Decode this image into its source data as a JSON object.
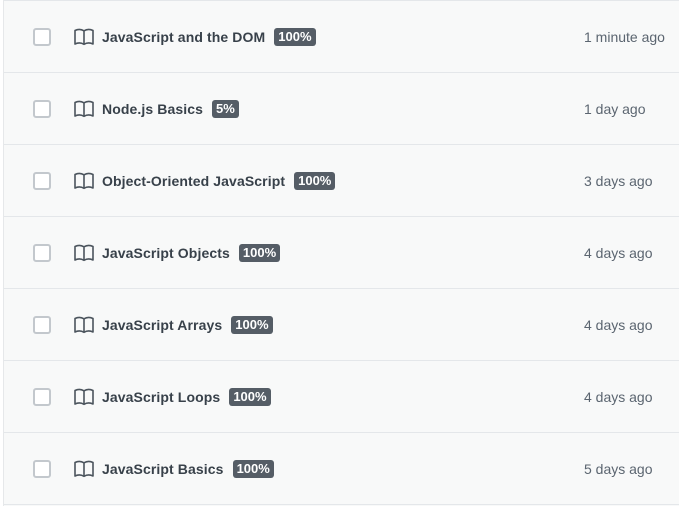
{
  "courses": [
    {
      "title": "JavaScript and the DOM",
      "progress": "100%",
      "time": "1 minute ago"
    },
    {
      "title": "Node.js Basics",
      "progress": "5%",
      "time": "1 day ago"
    },
    {
      "title": "Object-Oriented JavaScript",
      "progress": "100%",
      "time": "3 days ago"
    },
    {
      "title": "JavaScript Objects",
      "progress": "100%",
      "time": "4 days ago"
    },
    {
      "title": "JavaScript Arrays",
      "progress": "100%",
      "time": "4 days ago"
    },
    {
      "title": "JavaScript Loops",
      "progress": "100%",
      "time": "4 days ago"
    },
    {
      "title": "JavaScript Basics",
      "progress": "100%",
      "time": "5 days ago"
    }
  ],
  "icons": {
    "row_icon": "book-icon"
  },
  "colors": {
    "badge_bg": "#555d66",
    "title_text": "#38414a",
    "time_text": "#5b6570",
    "row_bg": "#f8f9f9"
  }
}
